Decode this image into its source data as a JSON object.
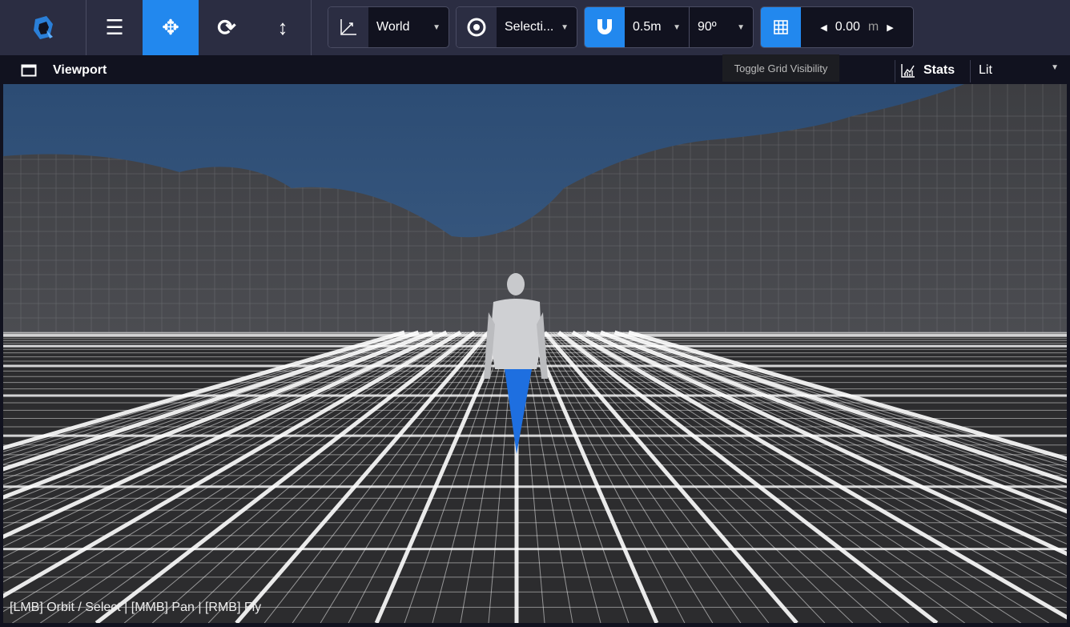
{
  "toolbar": {
    "logo": "app-logo",
    "tools": [
      {
        "icon": "menu-icon"
      },
      {
        "icon": "move-icon",
        "active": true
      },
      {
        "icon": "rotate-icon"
      },
      {
        "icon": "scale-icon"
      }
    ],
    "space": {
      "icon": "axes-icon",
      "value": "World"
    },
    "pivot": {
      "icon": "target-icon",
      "value": "Selecti..."
    },
    "snap": {
      "icon": "magnet-icon",
      "distance": "0.5m",
      "angle": "90º"
    },
    "grid": {
      "icon": "grid-icon",
      "value": "0.00",
      "unit": "m"
    }
  },
  "tooltip": "Toggle Grid Visibility",
  "header": {
    "title": "Viewport",
    "stats_label": "Stats",
    "shading": "Lit"
  },
  "viewport": {
    "help": "[LMB] Orbit / Select | [MMB] Pan | [RMB] Fly"
  },
  "colors": {
    "accent": "#2288ee",
    "toolbar": "#2b2d42",
    "header": "#11121f"
  }
}
